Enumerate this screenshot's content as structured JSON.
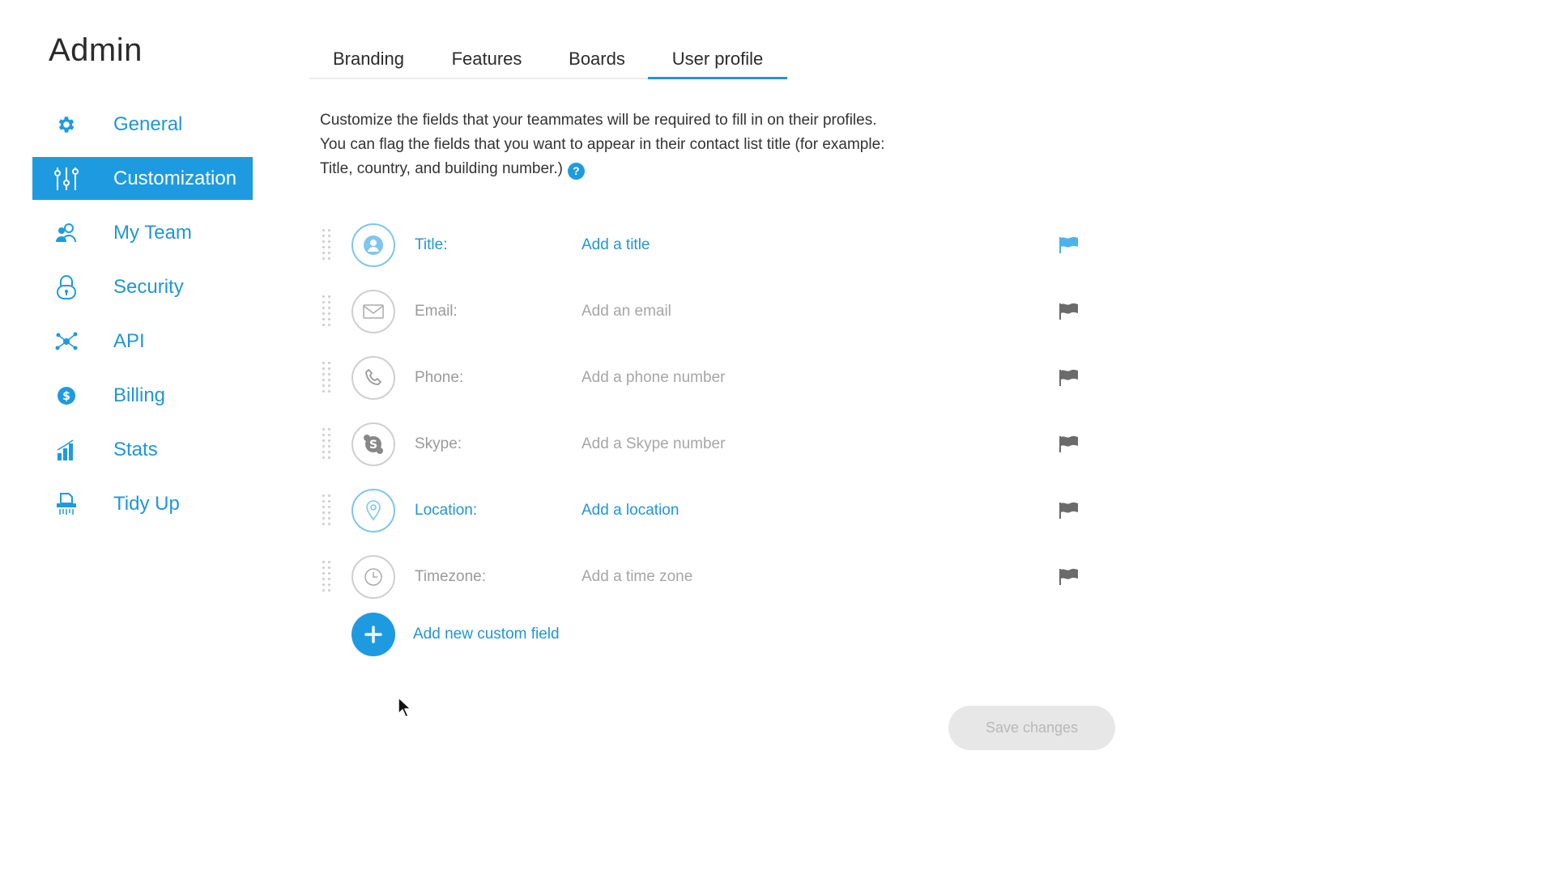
{
  "app": {
    "title": "Admin"
  },
  "sidebar": {
    "items": [
      {
        "label": "General",
        "icon": "gear-icon"
      },
      {
        "label": "Customization",
        "icon": "sliders-icon",
        "active": true
      },
      {
        "label": "My Team",
        "icon": "team-icon"
      },
      {
        "label": "Security",
        "icon": "lock-icon"
      },
      {
        "label": "API",
        "icon": "api-network-icon"
      },
      {
        "label": "Billing",
        "icon": "dollar-icon"
      },
      {
        "label": "Stats",
        "icon": "bar-chart-icon"
      },
      {
        "label": "Tidy Up",
        "icon": "shredder-icon"
      }
    ]
  },
  "tabs": [
    {
      "label": "Branding"
    },
    {
      "label": "Features"
    },
    {
      "label": "Boards"
    },
    {
      "label": "User profile",
      "active": true
    }
  ],
  "description": {
    "line1": "Customize the fields that your teammates will be required to fill in on their profiles.",
    "line2": "You can flag the fields that you want to appear in their contact list title (for example:",
    "line3": "Title, country, and building number.)",
    "help_symbol": "?"
  },
  "fields": [
    {
      "label": "Title:",
      "placeholder": "Add a title",
      "icon": "person-icon",
      "flagged": true
    },
    {
      "label": "Email:",
      "placeholder": "Add an email",
      "icon": "envelope-icon",
      "flagged": false
    },
    {
      "label": "Phone:",
      "placeholder": "Add a phone number",
      "icon": "phone-icon",
      "flagged": false
    },
    {
      "label": "Skype:",
      "placeholder": "Add a Skype number",
      "icon": "skype-icon",
      "flagged": false
    },
    {
      "label": "Location:",
      "placeholder": "Add a location",
      "icon": "location-pin-icon",
      "flagged": false
    },
    {
      "label": "Timezone:",
      "placeholder": "Add a time zone",
      "icon": "clock-icon",
      "flagged": false
    }
  ],
  "add_field": {
    "label": "Add new custom field"
  },
  "save": {
    "label": "Save changes"
  },
  "colors": {
    "accent": "#1e9be0",
    "link": "#2196d6",
    "muted": "#9a9a9a",
    "flag_active": "#4ab3ea",
    "flag_inactive": "#6b6b6b",
    "button_disabled_bg": "#e7e7e7"
  }
}
